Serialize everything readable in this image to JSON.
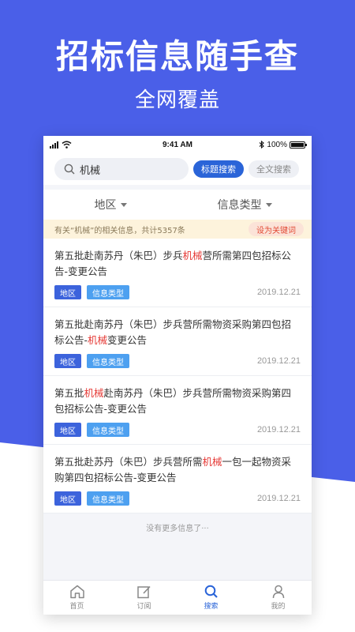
{
  "hero": {
    "title": "招标信息随手查",
    "subtitle": "全网覆盖"
  },
  "status_bar": {
    "time": "9:41 AM",
    "battery": "100%"
  },
  "search": {
    "value": "机械",
    "mode_active": "标题搜索",
    "mode_other": "全文搜索"
  },
  "filters": {
    "region": "地区",
    "info_type": "信息类型"
  },
  "notice": {
    "text": "有关“机械”的相关信息，共计5357条",
    "button": "设为关键词"
  },
  "results": [
    {
      "pre": "第五批赴南苏丹（朱巴）步兵",
      "hl": "机械",
      "post": "营所需第四包招标公告-变更公告",
      "tag_region": "地区",
      "tag_type": "信息类型",
      "date": "2019.12.21"
    },
    {
      "pre": "第五批赴南苏丹（朱巴）步兵营所需物资采购第四包招标公告-",
      "hl": "机械",
      "post": "变更公告",
      "tag_region": "地区",
      "tag_type": "信息类型",
      "date": "2019.12.21"
    },
    {
      "pre": "第五批",
      "hl": "机械",
      "post": "赴南苏丹（朱巴）步兵营所需物资采购第四包招标公告-变更公告",
      "tag_region": "地区",
      "tag_type": "信息类型",
      "date": "2019.12.21"
    },
    {
      "pre": "第五批赴苏丹（朱巴）步兵营所需",
      "hl": "机械",
      "post": "一包一起物资采购第四包招标公告-变更公告",
      "tag_region": "地区",
      "tag_type": "信息类型",
      "date": "2019.12.21"
    }
  ],
  "no_more": "没有更多信息了···",
  "tabbar": [
    {
      "label": "首页",
      "icon": "home-icon",
      "active": false
    },
    {
      "label": "订阅",
      "icon": "edit-icon",
      "active": false
    },
    {
      "label": "搜索",
      "icon": "search-icon",
      "active": true
    },
    {
      "label": "我的",
      "icon": "user-icon",
      "active": false
    }
  ],
  "colors": {
    "brand_blue": "#4a5fe8",
    "accent": "#2a64d8",
    "highlight": "#e53935"
  }
}
